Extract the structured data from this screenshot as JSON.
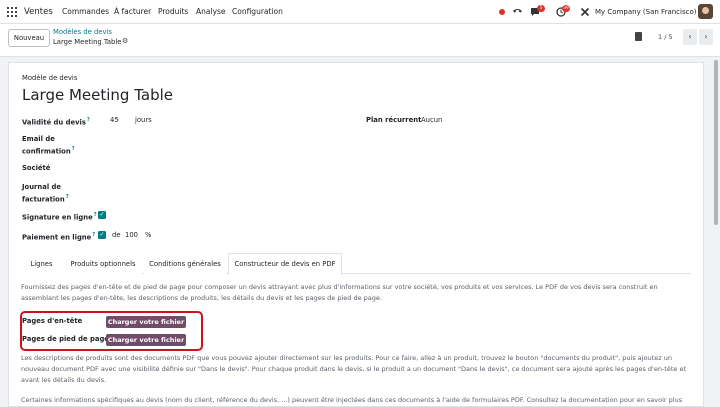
{
  "navbar": {
    "app_name": "Ventes",
    "menu": [
      "Commandes",
      "À facturer",
      "Produits",
      "Analyse",
      "Configuration"
    ],
    "chat_badge": "5",
    "activity_badge": "39",
    "company": "My Company (San Francisco)"
  },
  "control_panel": {
    "new_button": "Nouveau",
    "breadcrumb_parent": "Modèles de devis",
    "breadcrumb_current": "Large Meeting Table",
    "pager": "1 / 5"
  },
  "form": {
    "section_label": "Modèle de devis",
    "title": "Large Meeting Table",
    "validity_label": "Validité du devis",
    "validity_value": "45",
    "validity_unit": "jours",
    "recurring_label": "Plan récurrent",
    "recurring_value": "Aucun",
    "email_label_1": "Email de",
    "email_label_2": "confirmation",
    "company_label": "Société",
    "journal_label_1": "Journal de",
    "journal_label_2": "facturation",
    "signature_label": "Signature en ligne",
    "payment_label": "Paiement en ligne",
    "payment_of": "de",
    "payment_value": "100",
    "payment_unit": "%"
  },
  "tabs": [
    "Lignes",
    "Produits optionnels",
    "Conditions générales",
    "Constructeur de devis en PDF"
  ],
  "pdf_tab": {
    "intro": "Fournissez des pages d'en-tête et de pied de page pour composer un devis attrayant avec plus d'informations sur votre société, vos produits et vos services. Le PDF de vos devis sera construit en assemblant les pages d'en-tête, les descriptions de produits, les détails du devis et les pages de pied de page.",
    "header_pages_label": "Pages d'en-tête",
    "footer_pages_label": "Pages de pied de page",
    "upload_label": "Charger votre fichier",
    "product_desc": "Les descriptions de produits sont des documents PDF que vous pouvez ajouter directement sur les produits. Pour ce faire, allez à un produit, trouvez le bouton \"documents du produit\", puis ajoutez un nouveau document PDF avec une visibilité définie sur \"Dans le devis\". Pour chaque produit dans le devis, si le produit a un document \"Dans le devis\", ce document sera ajouté après les pages d'en-tête et avant les détails du devis.",
    "dynamic_info": "Certaines informations spécifiques au devis (nom du client, référence du devis, ...) peuvent être injectées dans ces documents à l'aide de formulaires PDF. Consultez la documentation pour en savoir plus sur"
  }
}
